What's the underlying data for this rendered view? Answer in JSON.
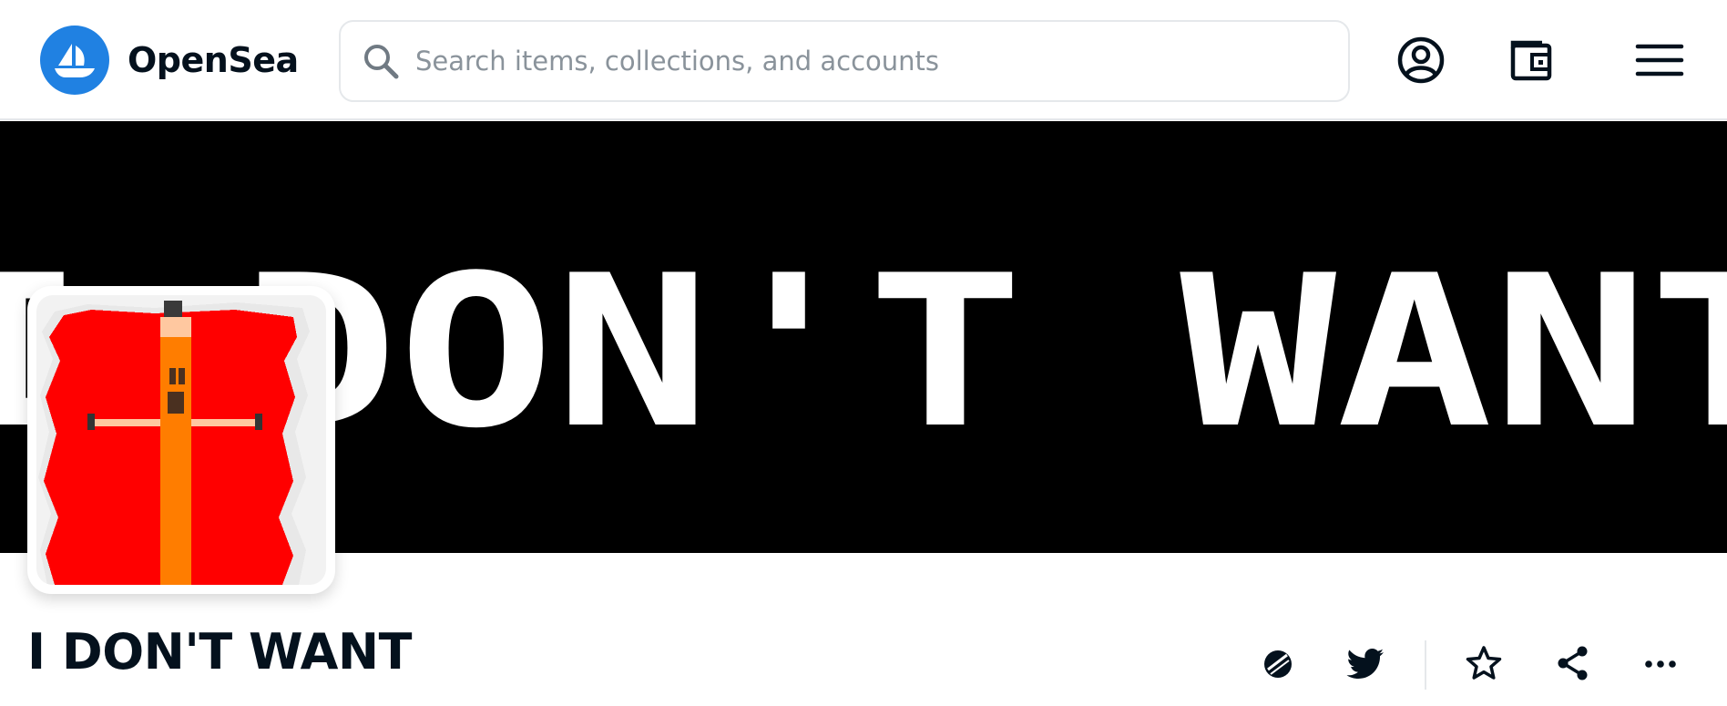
{
  "header": {
    "brand_name": "OpenSea",
    "logo_icon": "opensea-ship-icon",
    "search": {
      "placeholder": "Search items, collections, and accounts",
      "value": ""
    },
    "icons": [
      "account-icon",
      "wallet-icon",
      "menu-icon"
    ]
  },
  "banner": {
    "text": "I DON'T WANT",
    "background": "#000000",
    "text_color": "#ffffff"
  },
  "collection": {
    "title": "I DON'T WANT",
    "avatar_icon": "pixel-art-avatar"
  },
  "actions": [
    "opensea-link-icon",
    "twitter-icon",
    "star-icon",
    "share-icon",
    "more-options-icon"
  ],
  "colors": {
    "accent": "#2081e2",
    "text_primary": "#04111d",
    "placeholder": "#8a939b",
    "border": "#e5e8eb",
    "avatar_red": "#ff0000",
    "avatar_orange": "#ff7d00"
  }
}
